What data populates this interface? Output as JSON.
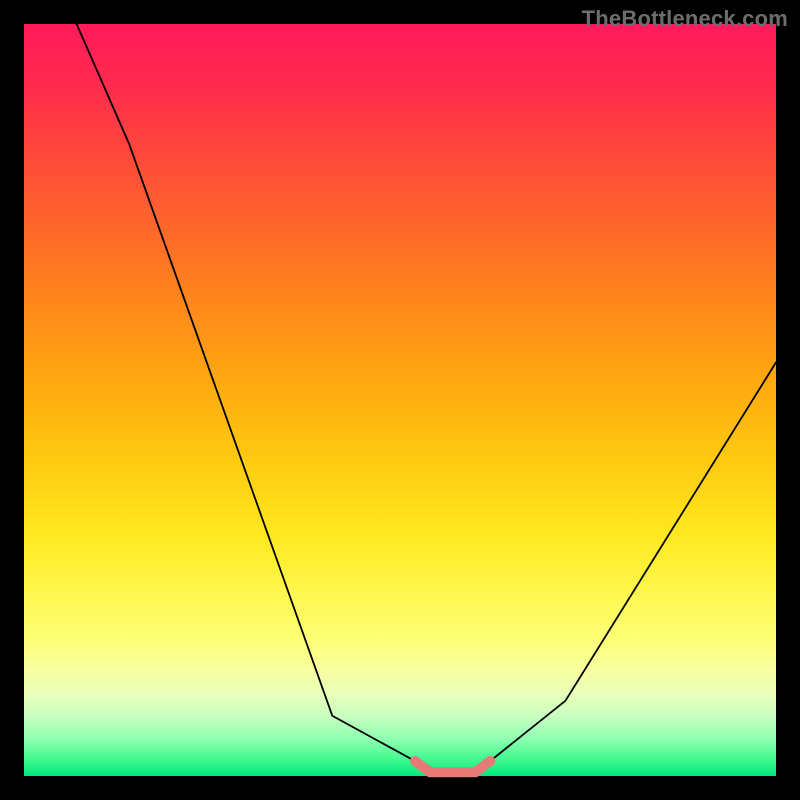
{
  "watermark": "TheBottleneck.com",
  "chart_data": {
    "type": "line",
    "title": "",
    "xlabel": "",
    "ylabel": "",
    "xlim": [
      0,
      100
    ],
    "ylim": [
      0,
      100
    ],
    "grid": false,
    "series": [
      {
        "name": "left-limb",
        "color": "#000000",
        "width": 1.8,
        "x": [
          7,
          14,
          41,
          52
        ],
        "y": [
          100,
          84,
          8,
          2
        ]
      },
      {
        "name": "right-limb",
        "color": "#000000",
        "width": 1.8,
        "x": [
          62,
          72,
          100
        ],
        "y": [
          2,
          10,
          55
        ]
      },
      {
        "name": "valley-highlight",
        "color": "#e77a77",
        "width": 10,
        "cap": "round",
        "x": [
          52,
          54,
          60,
          62
        ],
        "y": [
          2,
          0.5,
          0.5,
          2
        ]
      }
    ]
  }
}
